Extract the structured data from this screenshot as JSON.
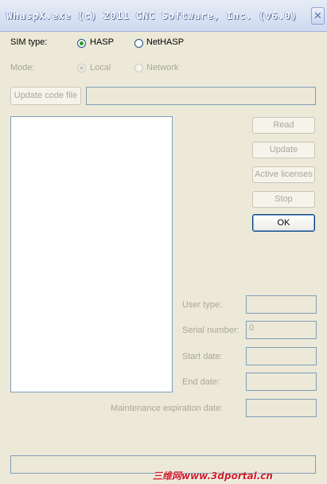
{
  "window": {
    "title": "WhaspX.exe (c) 2011 CNC Software, Inc. (v6.0)",
    "close_glyph": "✕"
  },
  "sim_type": {
    "label": "SIM type:",
    "options": [
      "HASP",
      "NetHASP"
    ],
    "selected": "HASP"
  },
  "mode": {
    "label": "Mode:",
    "options": [
      "Local",
      "Network"
    ],
    "selected": "Local",
    "enabled": false
  },
  "update_code_file": {
    "button_label": "Update code file",
    "path_value": ""
  },
  "buttons": {
    "read": "Read",
    "update": "Update",
    "active_licenses": "Active licenses",
    "stop": "Stop",
    "ok": "OK"
  },
  "info": {
    "user_type_label": "User type:",
    "user_type_value": "",
    "serial_number_label": "Serial number:",
    "serial_number_value": "0",
    "start_date_label": "Start date:",
    "start_date_value": "",
    "end_date_label": "End date:",
    "end_date_value": "",
    "maintenance_label": "Maintenance expiration date:",
    "maintenance_value": ""
  },
  "status_text": "",
  "watermark": "三维网www.3dportal.cn",
  "colors": {
    "dialog_bg": "#ece9d8",
    "title_gradient_top": "#e6ecf6",
    "radio_dot": "#21a121",
    "disabled_text": "#a8a799",
    "ok_border": "#003c74",
    "watermark": "#d0202a"
  }
}
